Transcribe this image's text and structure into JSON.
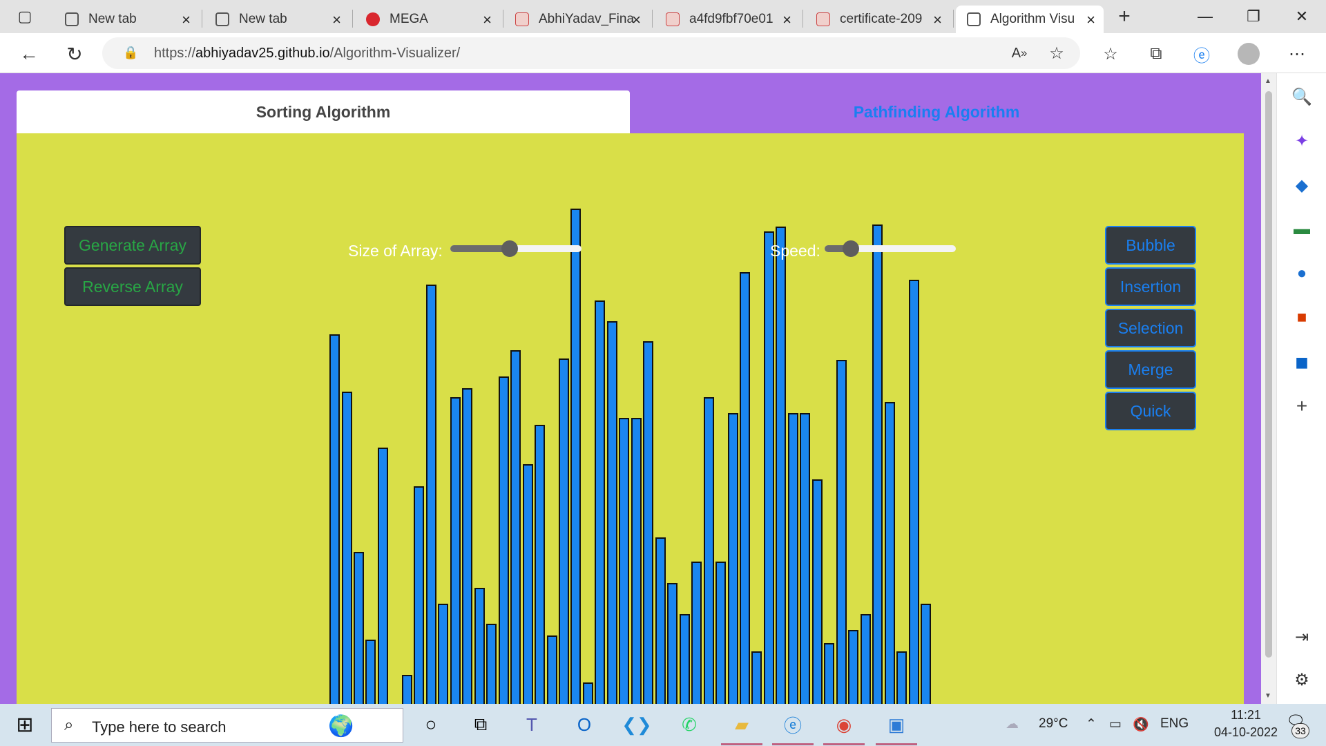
{
  "browser": {
    "tabs": [
      {
        "label": "New tab",
        "icon": "new-tab-page-icon"
      },
      {
        "label": "New tab",
        "icon": "new-tab-page-icon"
      },
      {
        "label": "MEGA",
        "icon": "mega-logo-icon"
      },
      {
        "label": "AbhiYadav_Fina",
        "icon": "pdf-icon"
      },
      {
        "label": "a4fd9fbf70e01",
        "icon": "pdf-icon"
      },
      {
        "label": "certificate-209",
        "icon": "pdf-icon"
      },
      {
        "label": "Algorithm Visu",
        "icon": "page-icon",
        "active": true
      }
    ],
    "address": {
      "protocol": "https://",
      "domain": "abhiyadav25.github.io",
      "path": "/Algorithm-Visualizer/"
    }
  },
  "app": {
    "tabs": {
      "sorting": "Sorting Algorithm",
      "pathfinding": "Pathfinding Algorithm"
    },
    "left_buttons": {
      "generate": "Generate Array",
      "reverse": "Reverse Array"
    },
    "sliders": {
      "size_label": "Size of Array:",
      "size_level": 0.45,
      "speed_label": "Speed:",
      "speed_level": 0.2
    },
    "algorithms": [
      "Bubble",
      "Insertion",
      "Selection",
      "Merge",
      "Quick"
    ],
    "colors": {
      "background": "#a46be6",
      "panel": "#d9df48",
      "bar": "#1a86f0",
      "button": "#343a40",
      "green_text": "#28a745",
      "blue_text": "#1a7ff0"
    },
    "array_values": [
      549,
      466,
      234,
      107,
      385,
      2,
      56,
      329,
      621,
      159,
      458,
      471,
      182,
      130,
      488,
      526,
      361,
      418,
      113,
      514,
      731,
      45,
      598,
      568,
      428,
      428,
      539,
      255,
      189,
      144,
      220,
      458,
      220,
      435,
      639,
      90,
      698,
      705,
      435,
      435,
      339,
      102,
      512,
      121,
      144,
      708,
      451,
      90,
      628,
      159
    ]
  },
  "taskbar": {
    "search_placeholder": "Type here to search",
    "weather": "29°C",
    "language": "ENG",
    "time": "11:21",
    "date": "04-10-2022",
    "notifications": "33"
  }
}
